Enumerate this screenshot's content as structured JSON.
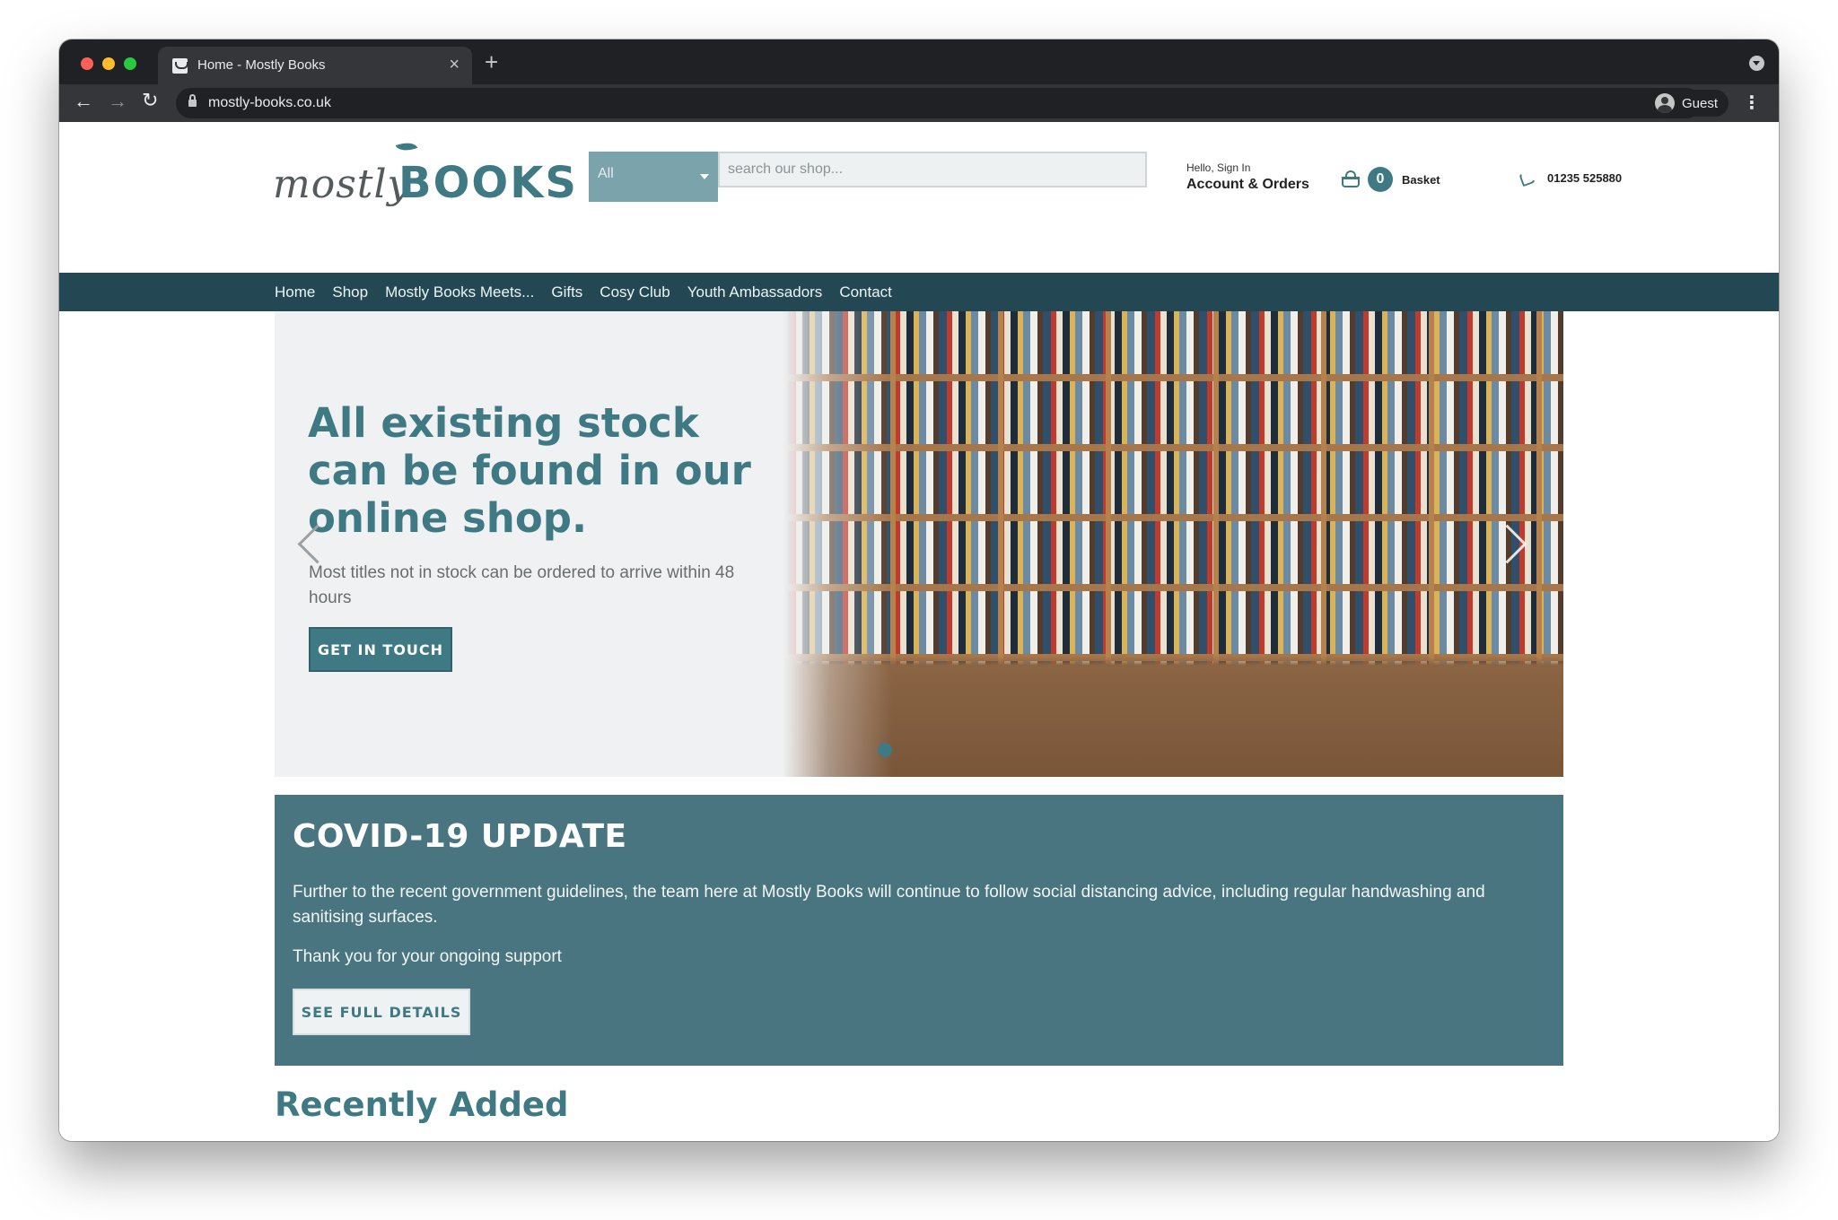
{
  "browser": {
    "tab_title": "Home - Mostly Books",
    "url": "mostly-books.co.uk",
    "profile_label": "Guest"
  },
  "logo": {
    "part1": "mostly",
    "part2": "BOOKS"
  },
  "search": {
    "category": "All",
    "placeholder": "search our shop..."
  },
  "account": {
    "greeting": "Hello, Sign In",
    "link": "Account & Orders"
  },
  "basket": {
    "count": "0",
    "label": "Basket"
  },
  "phone": "01235 525880",
  "nav": {
    "items": [
      "Home",
      "Shop",
      "Mostly Books Meets...",
      "Gifts",
      "Cosy Club",
      "Youth Ambassadors",
      "Contact"
    ]
  },
  "hero": {
    "heading": "All existing stock can be found in our online shop.",
    "subtext": "Most titles not in stock can be ordered to arrive within 48 hours",
    "button": "GET IN TOUCH"
  },
  "covid": {
    "title": "COVID-19 UPDATE",
    "body": "Further to the recent government guidelines, the team here at Mostly Books will continue to follow social distancing advice, including regular handwashing and sanitising surfaces.",
    "thanks": "Thank you for your ongoing support",
    "button": "SEE FULL DETAILS"
  },
  "recently_added": {
    "title": "Recently Added",
    "cover_colors": [
      "#efece0",
      "#7fb24a",
      "#1c1c1c",
      "#b9dbe3",
      "#a25ee6",
      "#ffffff"
    ]
  },
  "colors": {
    "brand_teal": "#3f7a84",
    "nav_dark": "#234854",
    "covid_panel": "#497581"
  }
}
